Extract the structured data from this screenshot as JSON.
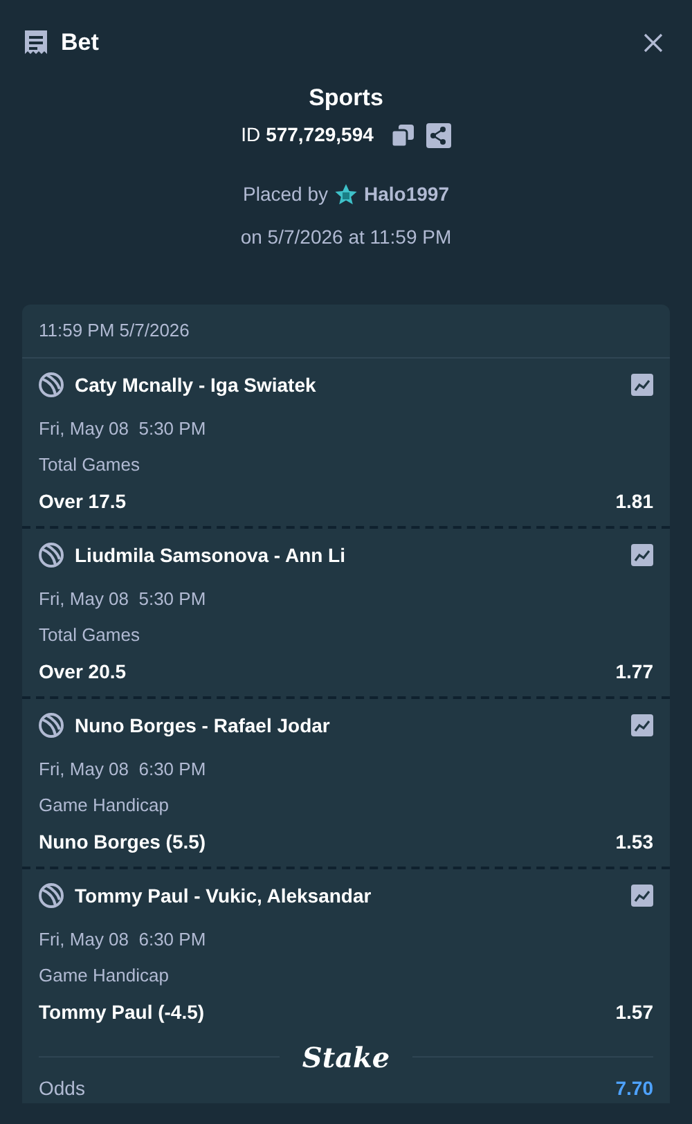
{
  "header": {
    "title": "Bet"
  },
  "summary": {
    "title": "Sports",
    "id_label": "ID",
    "id_value": "577,729,594",
    "placed_by": "Placed by",
    "user": "Halo1997",
    "placed_on": "on 5/7/2026 at 11:59 PM"
  },
  "card": {
    "timestamp": "11:59 PM 5/7/2026",
    "legs": [
      {
        "match": "Caty Mcnally - Iga Swiatek",
        "time": "Fri, May 08  5:30 PM",
        "market": "Total Games",
        "selection": "Over 17.5",
        "odds": "1.81"
      },
      {
        "match": "Liudmila Samsonova - Ann Li",
        "time": "Fri, May 08  5:30 PM",
        "market": "Total Games",
        "selection": "Over 20.5",
        "odds": "1.77"
      },
      {
        "match": "Nuno Borges - Rafael Jodar",
        "time": "Fri, May 08  6:30 PM",
        "market": "Game Handicap",
        "selection": "Nuno Borges (5.5)",
        "odds": "1.53"
      },
      {
        "match": "Tommy Paul - Vukic, Aleksandar",
        "time": "Fri, May 08  6:30 PM",
        "market": "Game Handicap",
        "selection": "Tommy Paul (-4.5)",
        "odds": "1.57"
      }
    ],
    "brand": "Stake",
    "odds_label": "Odds",
    "odds_value": "7.70"
  }
}
